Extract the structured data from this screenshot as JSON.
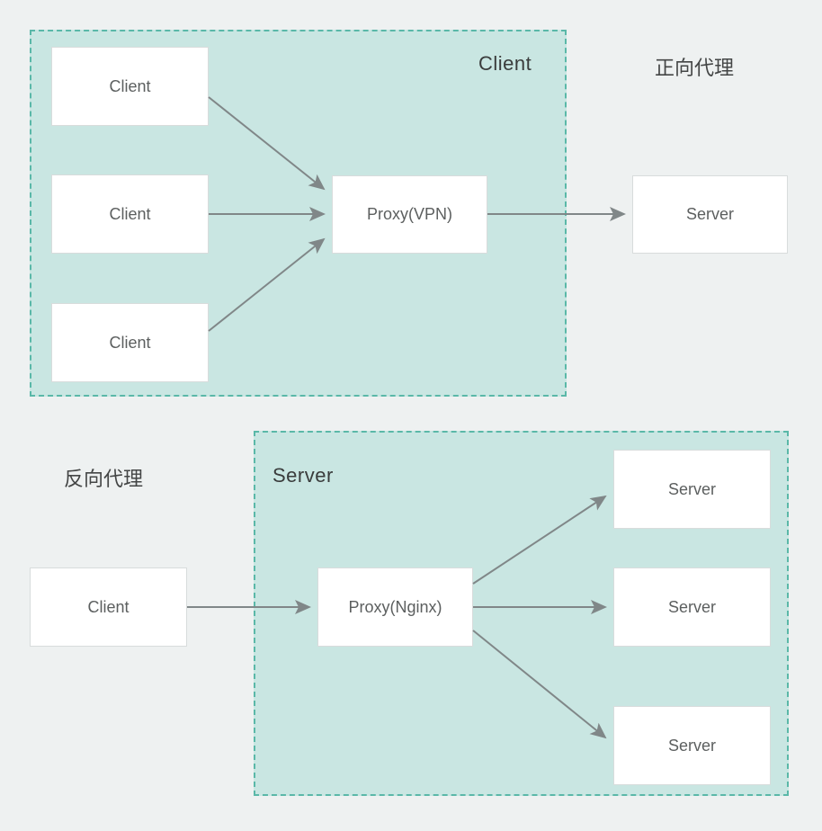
{
  "diagram": {
    "forward": {
      "title": "正向代理",
      "container_label": "Client",
      "clients": [
        "Client",
        "Client",
        "Client"
      ],
      "proxy": "Proxy(VPN)",
      "server": "Server"
    },
    "reverse": {
      "title": "反向代理",
      "container_label": "Server",
      "client": "Client",
      "proxy": "Proxy(Nginx)",
      "servers": [
        "Server",
        "Server",
        "Server"
      ]
    }
  }
}
